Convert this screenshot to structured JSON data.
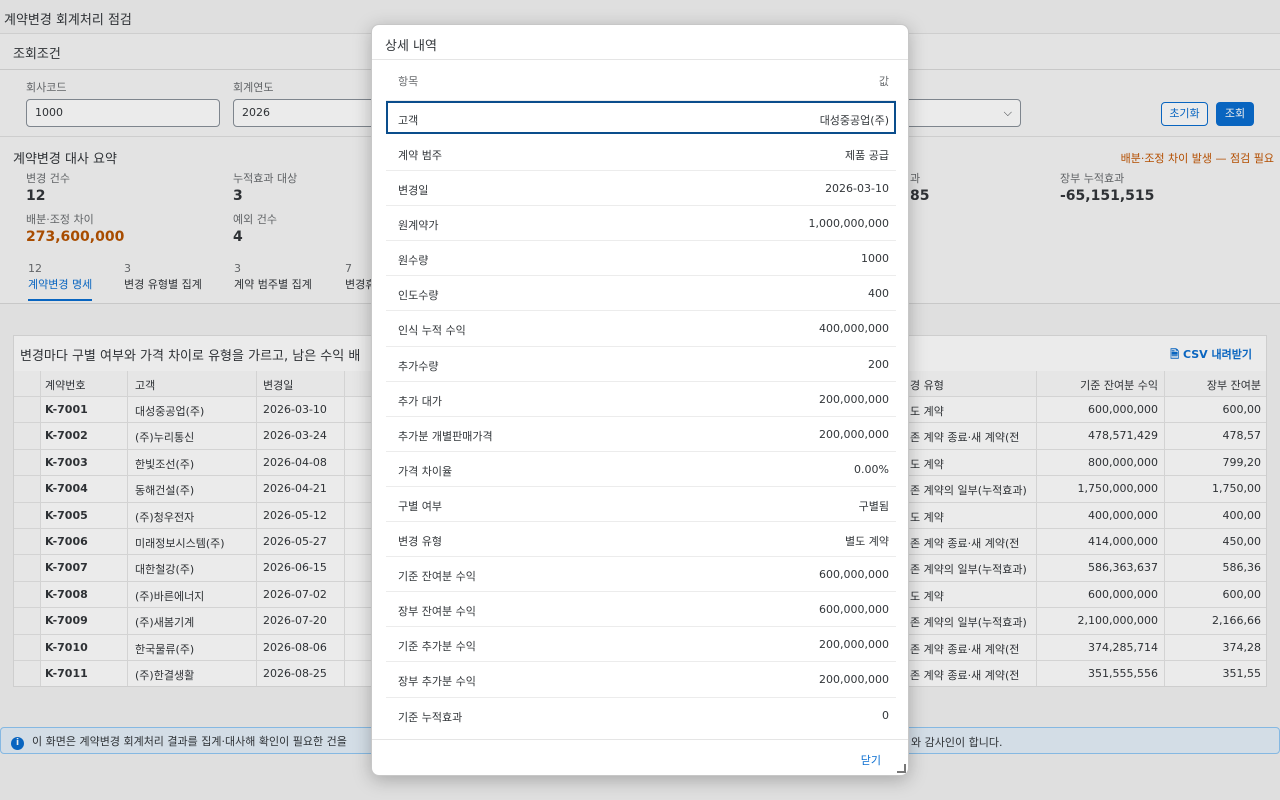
{
  "page": {
    "title": "계약변경 회계처리 점검"
  },
  "filters": {
    "header": "조회조건",
    "company_code_label": "회사코드",
    "company_code_value": "1000",
    "fiscal_year_label": "회계연도",
    "fiscal_year_value": "2026",
    "reset_label": "초기화",
    "search_label": "조회"
  },
  "summary": {
    "header": "계약변경 대사 요약",
    "warning": "배분·조정 차이 발생 — 점검 필요",
    "kpis": [
      {
        "label": "변경 건수",
        "value": "12"
      },
      {
        "label": "누적효과 대상",
        "value": "3"
      },
      {
        "label": "배분·조정 차이",
        "value": "273,600,000"
      },
      {
        "label": "예외 건수",
        "value": "4"
      },
      {
        "label": "과",
        "value": "85"
      },
      {
        "label": "장부 누적효과",
        "value": "-65,151,515"
      }
    ]
  },
  "tabs": [
    {
      "count": "12",
      "label": "계약변경 명세"
    },
    {
      "count": "3",
      "label": "변경 유형별 집계"
    },
    {
      "count": "3",
      "label": "계약 범주별 집계"
    },
    {
      "count": "7",
      "label": "변경휴"
    }
  ],
  "table": {
    "title": "변경마다 구별 여부와 가격 차이로 유형을 가르고, 남은 수익 배",
    "csv_label": "CSV 내려받기",
    "columns": [
      "계약번호",
      "고객",
      "변경일",
      "경 유형",
      "기준 잔여분 수익",
      "장부 잔여분"
    ],
    "rows": [
      [
        "K-7001",
        "대성중공업(주)",
        "2026-03-10",
        "도 계약",
        "600,000,000",
        "600,00"
      ],
      [
        "K-7002",
        "(주)누리통신",
        "2026-03-24",
        "존 계약 종료·새 계약(전",
        "478,571,429",
        "478,57"
      ],
      [
        "K-7003",
        "한빛조선(주)",
        "2026-04-08",
        "도 계약",
        "800,000,000",
        "799,20"
      ],
      [
        "K-7004",
        "동해건설(주)",
        "2026-04-21",
        "존 계약의 일부(누적효과)",
        "1,750,000,000",
        "1,750,00"
      ],
      [
        "K-7005",
        "(주)청우전자",
        "2026-05-12",
        "도 계약",
        "400,000,000",
        "400,00"
      ],
      [
        "K-7006",
        "미래정보시스템(주)",
        "2026-05-27",
        "존 계약 종료·새 계약(전",
        "414,000,000",
        "450,00"
      ],
      [
        "K-7007",
        "대한철강(주)",
        "2026-06-15",
        "존 계약의 일부(누적효과)",
        "586,363,637",
        "586,36"
      ],
      [
        "K-7008",
        "(주)바른에너지",
        "2026-07-02",
        "도 계약",
        "600,000,000",
        "600,00"
      ],
      [
        "K-7009",
        "(주)새봄기계",
        "2026-07-20",
        "존 계약의 일부(누적효과)",
        "2,100,000,000",
        "2,166,66"
      ],
      [
        "K-7010",
        "한국물류(주)",
        "2026-08-06",
        "존 계약 종료·새 계약(전",
        "374,285,714",
        "374,28"
      ],
      [
        "K-7011",
        "(주)한결생활",
        "2026-08-25",
        "존 계약 종료·새 계약(전",
        "351,555,556",
        "351,55"
      ]
    ]
  },
  "info": {
    "text": "이 화면은 계약변경 회계처리 결과를 집계·대사해 확인이 필요한 건을",
    "tail": "와 감사인이 합니다."
  },
  "dialog": {
    "title": "상세 내역",
    "header": {
      "label": "항목",
      "value": "값"
    },
    "rows": [
      {
        "label": "고객",
        "value": "대성중공업(주)"
      },
      {
        "label": "계약 범주",
        "value": "제품 공급"
      },
      {
        "label": "변경일",
        "value": "2026-03-10"
      },
      {
        "label": "원계약가",
        "value": "1,000,000,000"
      },
      {
        "label": "원수량",
        "value": "1000"
      },
      {
        "label": "인도수량",
        "value": "400"
      },
      {
        "label": "인식 누적 수익",
        "value": "400,000,000"
      },
      {
        "label": "추가수량",
        "value": "200"
      },
      {
        "label": "추가 대가",
        "value": "200,000,000"
      },
      {
        "label": "추가분 개별판매가격",
        "value": "200,000,000"
      },
      {
        "label": "가격 차이율",
        "value": "0.00%"
      },
      {
        "label": "구별 여부",
        "value": "구별됨"
      },
      {
        "label": "변경 유형",
        "value": "별도 계약"
      },
      {
        "label": "기준 잔여분 수익",
        "value": "600,000,000"
      },
      {
        "label": "장부 잔여분 수익",
        "value": "600,000,000"
      },
      {
        "label": "기준 추가분 수익",
        "value": "200,000,000"
      },
      {
        "label": "장부 추가분 수익",
        "value": "200,000,000"
      },
      {
        "label": "기준 누적효과",
        "value": "0"
      }
    ],
    "close_label": "닫기"
  }
}
